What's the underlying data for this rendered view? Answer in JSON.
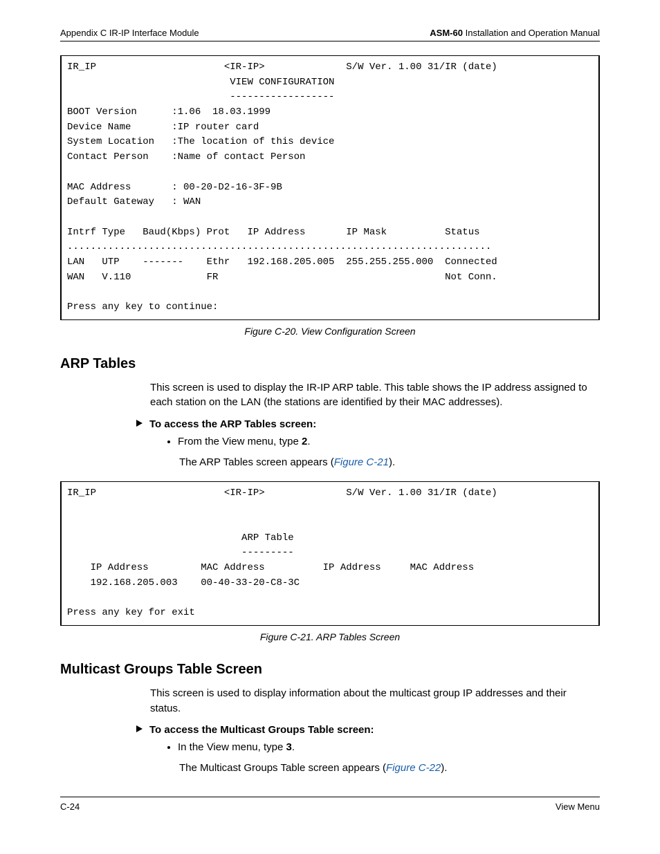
{
  "header": {
    "left": "Appendix C  IR-IP Interface Module",
    "right_bold": "ASM-60",
    "right_rest": " Installation and Operation Manual"
  },
  "terminal1": {
    "lines": [
      "IR_IP                      <IR-IP>              S/W Ver. 1.00 31/IR (date)",
      "                            VIEW CONFIGURATION",
      "                            ------------------",
      "BOOT Version      :1.06  18.03.1999",
      "Device Name       :IP router card",
      "System Location   :The location of this device",
      "Contact Person    :Name of contact Person",
      "",
      "MAC Address       : 00-20-D2-16-3F-9B",
      "Default Gateway   : WAN",
      "",
      "Intrf Type   Baud(Kbps) Prot   IP Address       IP Mask          Status",
      ".........................................................................",
      "LAN   UTP    -------    Ethr   192.168.205.005  255.255.255.000  Connected",
      "WAN   V.110             FR                                       Not Conn.",
      "",
      "Press any key to continue:"
    ]
  },
  "caption1": "Figure C-20.  View Configuration Screen",
  "sec1": {
    "title": "ARP Tables",
    "para": "This screen is used to display the IR-IP ARP table. This table shows the IP address assigned to each station on the LAN (the stations are identified by their MAC addresses).",
    "proc": "To access the ARP Tables screen:",
    "bullet_pre": "From the View menu, type ",
    "bullet_key": "2",
    "bullet_post": ".",
    "result_pre": "The ARP Tables screen appears (",
    "result_link": "Figure C-21",
    "result_post": ")."
  },
  "terminal2": {
    "lines": [
      "IR_IP                      <IR-IP>              S/W Ver. 1.00 31/IR (date)",
      "",
      "",
      "                              ARP Table",
      "                              ---------",
      "    IP Address         MAC Address          IP Address     MAC Address",
      "    192.168.205.003    00-40-33-20-C8-3C",
      "",
      "Press any key for exit"
    ]
  },
  "caption2": "Figure C-21.  ARP Tables Screen",
  "sec2": {
    "title": "Multicast Groups Table Screen",
    "para": "This screen is used to display information about the multicast group IP addresses and their status.",
    "proc": "To access the Multicast Groups Table screen:",
    "bullet_pre": "In the View menu, type ",
    "bullet_key": "3",
    "bullet_post": ".",
    "result_pre": "The Multicast Groups Table screen appears (",
    "result_link": "Figure C-22",
    "result_post": ")."
  },
  "footer": {
    "left": "C-24",
    "right": "View Menu"
  }
}
